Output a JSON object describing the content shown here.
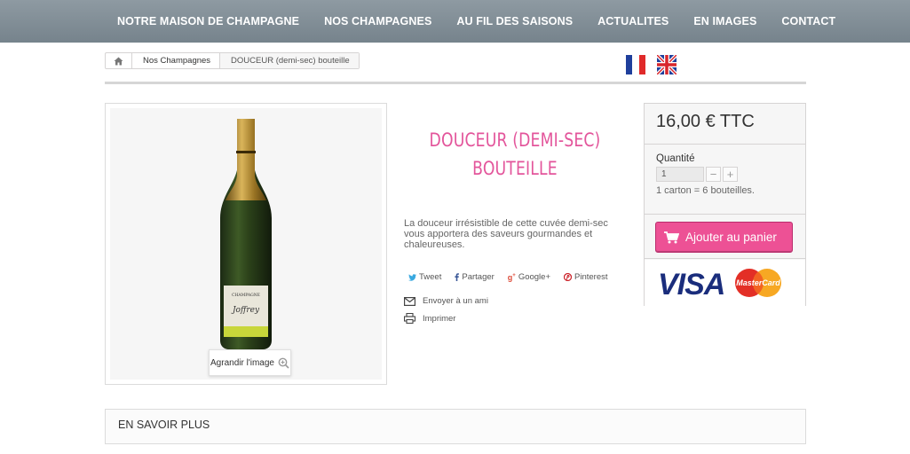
{
  "nav": {
    "items": [
      "NOTRE MAISON DE CHAMPAGNE",
      "NOS CHAMPAGNES",
      "AU FIL DES SAISONS",
      "ACTUALITES",
      "EN IMAGES",
      "CONTACT"
    ]
  },
  "breadcrumb": {
    "home_icon": "home-icon",
    "items": [
      "Nos Champagnes",
      "DOUCEUR (demi-sec) bouteille"
    ]
  },
  "languages": [
    "french-flag-icon",
    "english-flag-icon"
  ],
  "image": {
    "enlarge_label": "Agrandir l'image",
    "bottle_label_lines": [
      "CHAMPAGNE",
      "Joffrey"
    ]
  },
  "product": {
    "title_line1": "DOUCEUR (DEMI-SEC)",
    "title_line2": "BOUTEILLE",
    "description": "La douceur irrésistible de cette cuvée demi-sec vous apportera des saveurs gourmandes et chaleureuses.",
    "social": {
      "tweet": "Tweet",
      "share": "Partager",
      "google": "Google+",
      "pinterest": "Pinterest"
    },
    "send_friend": "Envoyer à un ami",
    "print": "Imprimer"
  },
  "buybox": {
    "price": "16,00 € TTC",
    "quantity_label": "Quantité",
    "quantity_value": "1",
    "minus": "−",
    "plus": "+",
    "carton_note": "1 carton = 6 bouteilles.",
    "add_to_cart": "Ajouter au panier",
    "visa": "VISA",
    "mastercard": "MasterCard"
  },
  "more_section": {
    "title": "En savoir plus"
  },
  "colors": {
    "accent_pink": "#ed5195",
    "title_pink": "#e3559b",
    "nav_bg": "#808c95"
  }
}
